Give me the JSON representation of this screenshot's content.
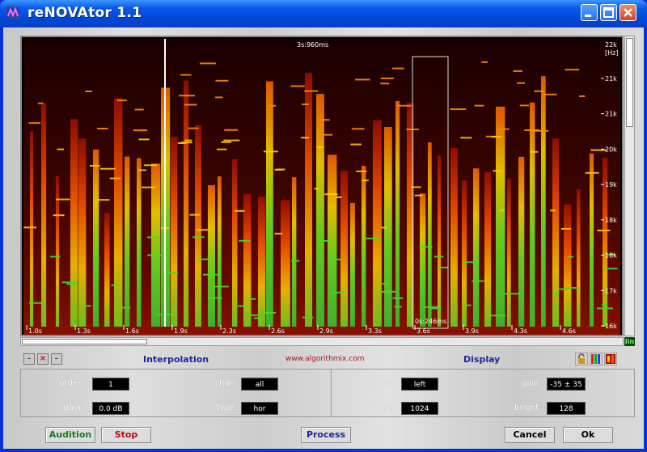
{
  "window": {
    "title": "reNOVAtor 1.1",
    "minimize_icon": "minimize-icon",
    "maximize_icon": "maximize-icon",
    "close_icon": "close-icon"
  },
  "spectrogram": {
    "cursor_time_label": "3s:960ms",
    "selection_label": "0s:246ms",
    "x_tick_labels": [
      "1.0s",
      "1.3s",
      "1.6s",
      "1.9s",
      "2.3s",
      "2.6s",
      "2.9s",
      "3.3s",
      "3.6s",
      "3.9s",
      "4.3s",
      "4.6s"
    ],
    "freq_unit_labels": [
      "22k",
      "[Hz]"
    ],
    "y_tick_labels": [
      "21k",
      "21k",
      "20k",
      "19k",
      "18k",
      "18k",
      "17k",
      "16k"
    ],
    "scale_mode": "lin",
    "colors": {
      "background": "#000000",
      "low": "#8a0000",
      "mid": "#ff4400",
      "high": "#ffdd00",
      "peak": "#33dd33"
    }
  },
  "controls_bar": {
    "minus_label": "–",
    "x_label": "×",
    "plus_label": "–",
    "interpolation_title": "Interpolation",
    "url": "www.algorithmix.com",
    "display_title": "Display",
    "icons": [
      "lock-icon",
      "palette-icon",
      "color-map-icon"
    ]
  },
  "interpolation": {
    "order_label": "order",
    "order_value": "1",
    "gain_label": "gain",
    "gain_value": "0.0 dB",
    "chan_label": "chan",
    "chan_value": "all",
    "type_label": "type",
    "type_value": "hor"
  },
  "display": {
    "channel_label": "channel",
    "channel_value": "left",
    "blksize_label": "blksize",
    "blksize_value": "1024",
    "gain_label": "gain",
    "gain_value": "-35 ± 35",
    "bright_label": "bright",
    "bright_value": "128"
  },
  "buttons": {
    "audition": "Audition",
    "stop": "Stop",
    "process": "Process",
    "cancel": "Cancel",
    "ok": "Ok"
  }
}
